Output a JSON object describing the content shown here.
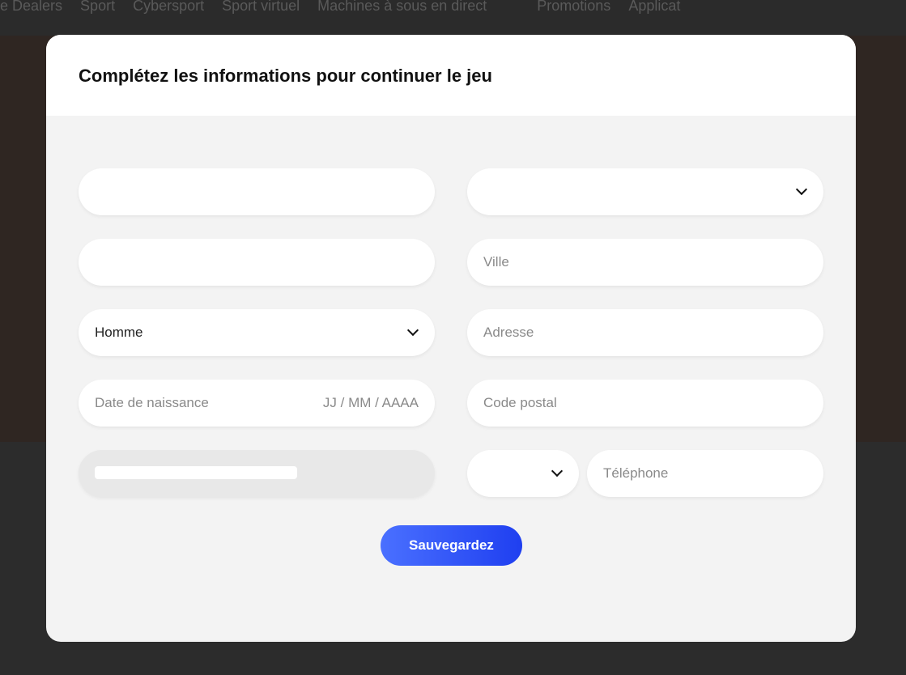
{
  "nav": [
    "e Dealers",
    "Sport",
    "Cybersport",
    "Sport virtuel",
    "Machines à sous en direct",
    "Promotions",
    "Applicat"
  ],
  "modal": {
    "title": "Complétez les informations pour continuer le jeu",
    "fields": {
      "first_name": "",
      "country": "",
      "last_name": "",
      "city_placeholder": "Ville",
      "gender": "Homme",
      "address_placeholder": "Adresse",
      "birthdate_placeholder": "Date de naissance",
      "birthdate_hint": "JJ / MM / AAAA",
      "postal_placeholder": "Code postal",
      "email": "",
      "phone_code": "",
      "phone_placeholder": "Téléphone"
    },
    "save_label": "Sauvegardez"
  }
}
